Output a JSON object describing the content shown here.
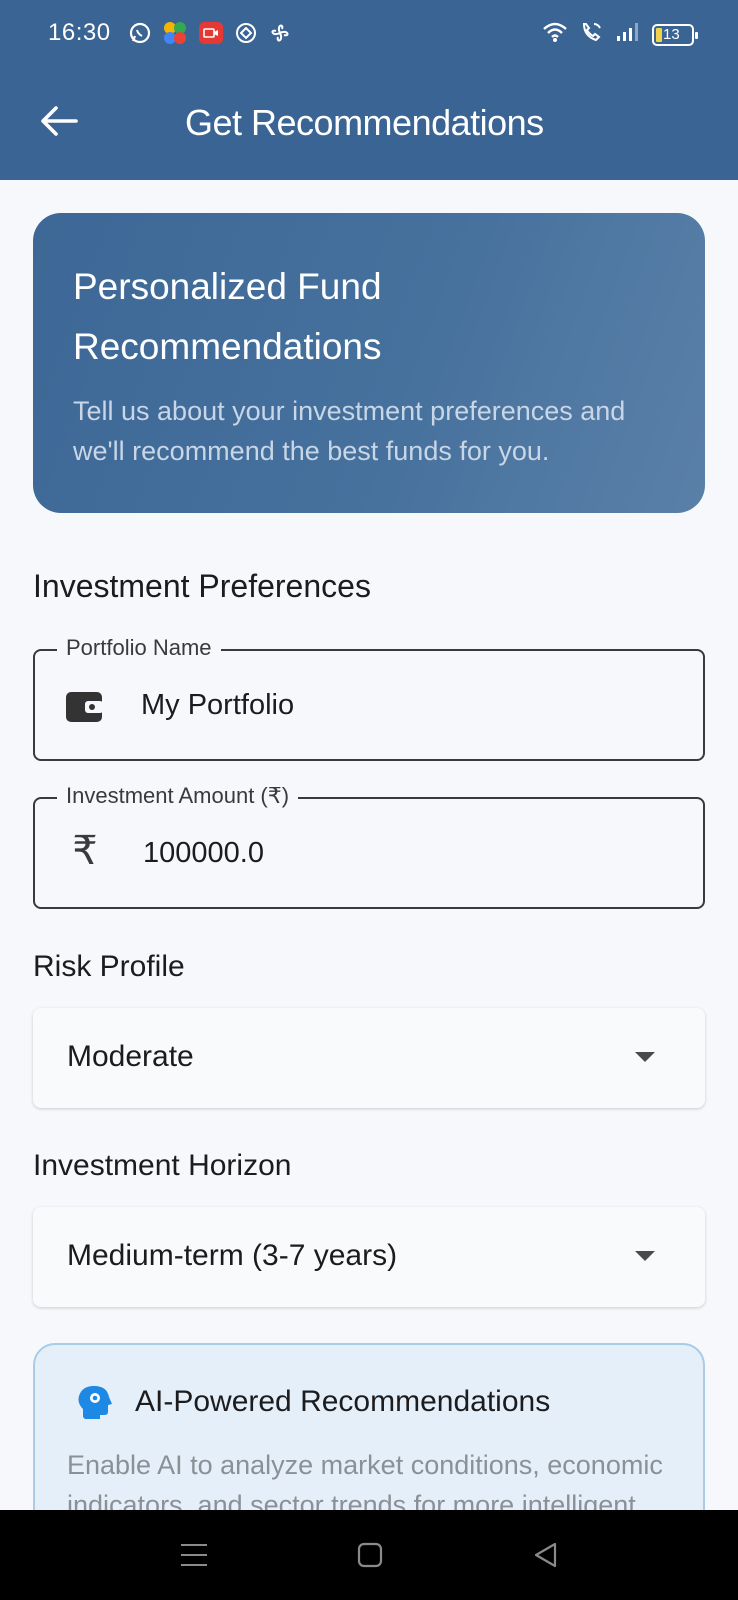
{
  "status_bar": {
    "time": "16:30",
    "battery": "13",
    "app_icons": [
      "whatsapp-icon",
      "pinwheel-icon",
      "video-call-icon",
      "shield-icon",
      "fan-icon"
    ],
    "system_icons": [
      "wifi-icon",
      "wifi-call-icon",
      "signal-icon",
      "battery-icon"
    ]
  },
  "app_bar": {
    "title": "Get Recommendations",
    "back_icon": "arrow-left-icon"
  },
  "hero": {
    "title": "Personalized Fund Recommendations",
    "description": "Tell us about your investment preferences and we'll recommend the best funds for you."
  },
  "form": {
    "section_title": "Investment Preferences",
    "portfolio_name": {
      "label": "Portfolio Name",
      "value": "My Portfolio",
      "icon": "wallet-icon"
    },
    "investment_amount": {
      "label": "Investment Amount (₹)",
      "value": "100000.0",
      "icon": "₹"
    },
    "risk_profile": {
      "label": "Risk Profile",
      "selected": "Moderate"
    },
    "investment_horizon": {
      "label": "Investment Horizon",
      "selected": "Medium-term (3-7 years)"
    }
  },
  "ai_card": {
    "title": "AI-Powered Recommendations",
    "description": "Enable AI to analyze market conditions, economic indicators, and sector trends for more intelligent",
    "icon": "ai-brain-icon"
  },
  "colors": {
    "primary": "#3a6494",
    "background": "#f6f8fc",
    "ai_card_bg": "#e4eff9",
    "ai_card_border": "#a9cbe6"
  },
  "nav_bar": [
    "menu-icon",
    "home-square-icon",
    "back-triangle-icon"
  ]
}
